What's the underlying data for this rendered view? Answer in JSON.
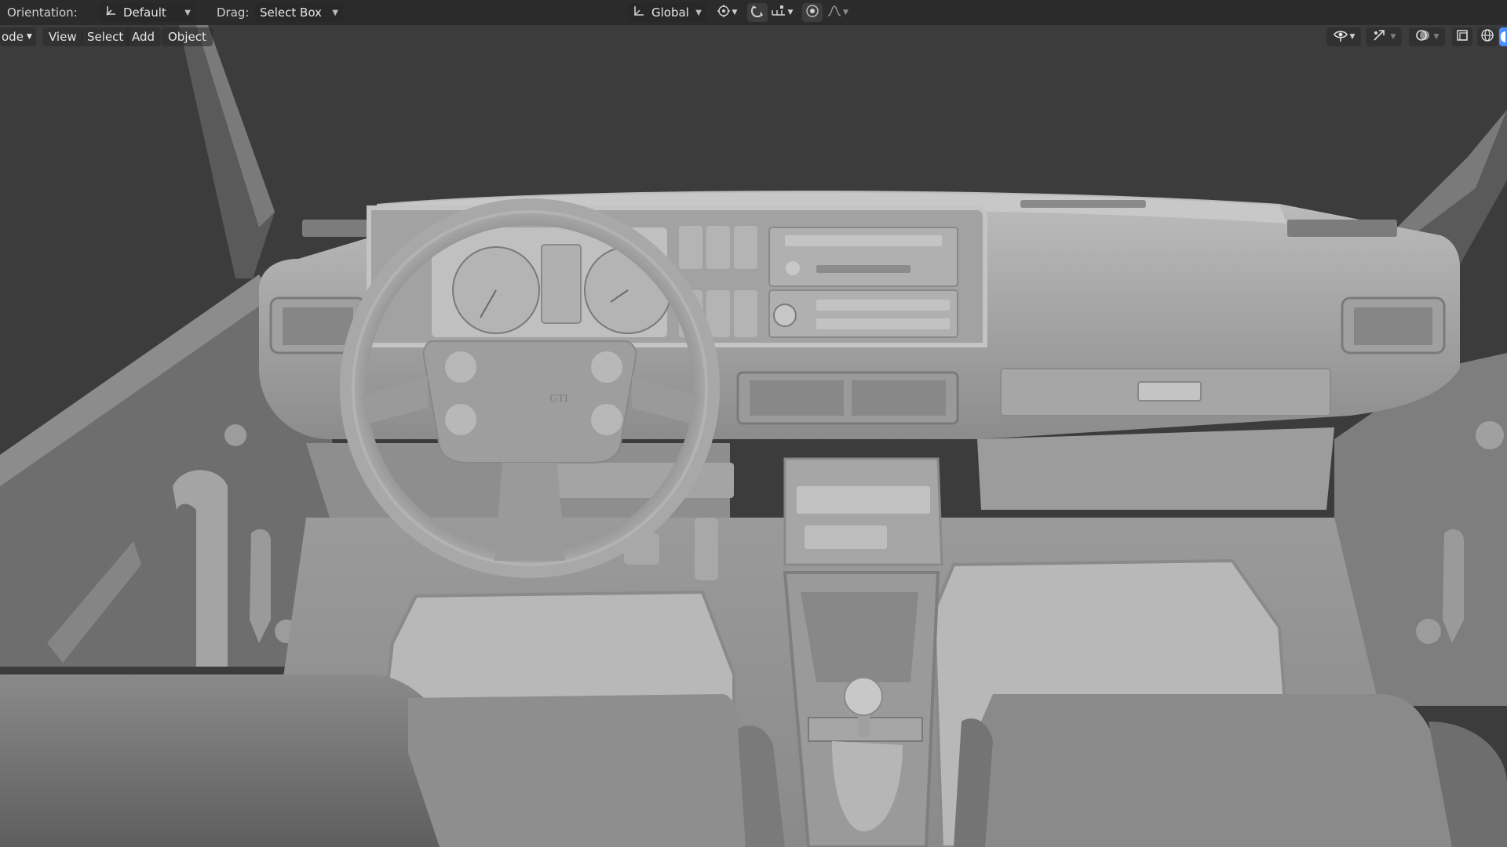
{
  "tool_header": {
    "orientation_label": "Orientation:",
    "orientation_value": "Default",
    "drag_label": "Drag:",
    "drag_value": "Select Box",
    "transform_orientation": "Global"
  },
  "viewport_header": {
    "mode_label": "ode",
    "menus": [
      "View",
      "Select",
      "Add",
      "Object"
    ]
  },
  "model": {
    "steering_badge": "GTI"
  },
  "colors": {
    "background": "#3c3c3c",
    "header": "#2b2b2b",
    "clay": "#8f8f8f",
    "accent": "#4a8eff"
  },
  "icons": [
    "orientation-icon",
    "global-axes-icon",
    "pivot-icon",
    "snap-icon",
    "snap-increment-icon",
    "proportional-editing-icon",
    "falloff-icon",
    "visibility-icon",
    "gizmo-icon",
    "overlay-icon",
    "xray-icon",
    "wireframe-shading-icon",
    "solid-shading-icon"
  ]
}
